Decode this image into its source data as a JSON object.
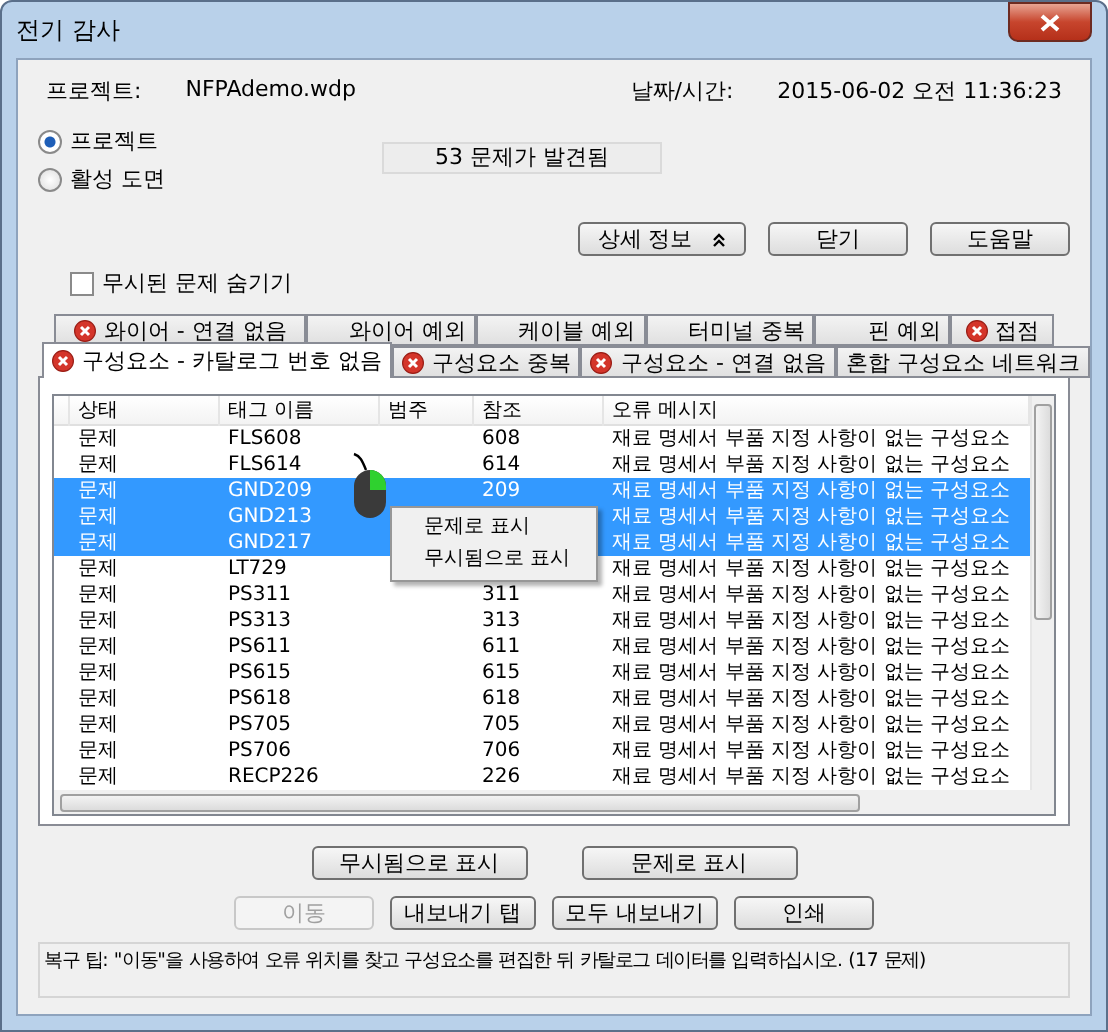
{
  "window": {
    "title": "전기 감사"
  },
  "project": {
    "label": "프로젝트:",
    "value": "NFPAdemo.wdp"
  },
  "datetime": {
    "label": "날짜/시간:",
    "value": "2015-06-02  오전 11:36:23"
  },
  "scope": [
    {
      "label": "프로젝트",
      "selected": true
    },
    {
      "label": "활성 도면",
      "selected": false
    }
  ],
  "found": "53 문제가 발견됨",
  "top_buttons": [
    {
      "label": "상세 정보",
      "kind": "expander"
    },
    {
      "label": "닫기",
      "kind": "plain"
    },
    {
      "label": "도움말",
      "kind": "plain"
    }
  ],
  "hide_ignored": {
    "label": "무시된 문제 숨기기",
    "checked": false
  },
  "tabs_back": [
    {
      "label": "와이어 - 연결 없음",
      "error": true,
      "selected": false
    },
    {
      "label": "와이어 예외",
      "error": false,
      "selected": false
    },
    {
      "label": "케이블 예외",
      "error": false,
      "selected": false
    },
    {
      "label": "터미널 중복",
      "error": false,
      "selected": false
    },
    {
      "label": "핀 예외",
      "error": false,
      "selected": false
    },
    {
      "label": "접점",
      "error": true,
      "selected": false
    }
  ],
  "tabs_front": [
    {
      "label": "구성요소 - 카탈로그 번호 없음",
      "error": true,
      "selected": true
    },
    {
      "label": "구성요소 중복",
      "error": true,
      "selected": false
    },
    {
      "label": "구성요소 - 연결 없음",
      "error": true,
      "selected": false
    },
    {
      "label": "혼합 구성요소 네트워크",
      "error": false,
      "selected": false
    }
  ],
  "table": {
    "columns": [
      "상태",
      "태그 이름",
      "범주",
      "참조",
      "오류 메시지"
    ],
    "rows": [
      {
        "status": "문제",
        "tag": "FLS608",
        "ref": "608",
        "message": "재료 명세서 부품 지정 사항이 없는 구성요소",
        "selected": false
      },
      {
        "status": "문제",
        "tag": "FLS614",
        "ref": "614",
        "message": "재료 명세서 부품 지정 사항이 없는 구성요소",
        "selected": false
      },
      {
        "status": "문제",
        "tag": "GND209",
        "ref": "209",
        "message": "재료 명세서 부품 지정 사항이 없는 구성요소",
        "selected": true
      },
      {
        "status": "문제",
        "tag": "GND213",
        "message": "재료 명세서 부품 지정 사항이 없는 구성요소",
        "selected": true
      },
      {
        "status": "문제",
        "tag": "GND217",
        "message": "재료 명세서 부품 지정 사항이 없는 구성요소",
        "selected": true
      },
      {
        "status": "문제",
        "tag": "LT729",
        "message": "재료 명세서 부품 지정 사항이 없는 구성요소",
        "selected": false
      },
      {
        "status": "문제",
        "tag": "PS311",
        "ref": "311",
        "message": "재료 명세서 부품 지정 사항이 없는 구성요소",
        "selected": false
      },
      {
        "status": "문제",
        "tag": "PS313",
        "ref": "313",
        "message": "재료 명세서 부품 지정 사항이 없는 구성요소",
        "selected": false
      },
      {
        "status": "문제",
        "tag": "PS611",
        "ref": "611",
        "message": "재료 명세서 부품 지정 사항이 없는 구성요소",
        "selected": false
      },
      {
        "status": "문제",
        "tag": "PS615",
        "ref": "615",
        "message": "재료 명세서 부품 지정 사항이 없는 구성요소",
        "selected": false
      },
      {
        "status": "문제",
        "tag": "PS618",
        "ref": "618",
        "message": "재료 명세서 부품 지정 사항이 없는 구성요소",
        "selected": false
      },
      {
        "status": "문제",
        "tag": "PS705",
        "ref": "705",
        "message": "재료 명세서 부품 지정 사항이 없는 구성요소",
        "selected": false
      },
      {
        "status": "문제",
        "tag": "PS706",
        "ref": "706",
        "message": "재료 명세서 부품 지정 사항이 없는 구성요소",
        "selected": false
      },
      {
        "status": "문제",
        "tag": "RECP226",
        "ref": "226",
        "message": "재료 명세서 부품 지정 사항이 없는 구성요소",
        "selected": false
      }
    ]
  },
  "context_menu": [
    "문제로 표시",
    "무시됨으로 표시"
  ],
  "mark_buttons": [
    "무시됨으로 표시",
    "문제로 표시"
  ],
  "action_buttons": [
    {
      "label": "이동",
      "disabled": true
    },
    {
      "label": "내보내기 탭",
      "disabled": false
    },
    {
      "label": "모두 내보내기",
      "disabled": false
    },
    {
      "label": "인쇄",
      "disabled": false
    }
  ],
  "tip": "복구 팁: \"이동\"을 사용하여 오류 위치를 찾고 구성요소를 편집한 뒤 카탈로그 데이터를 입력하십시오. (17 문제)"
}
